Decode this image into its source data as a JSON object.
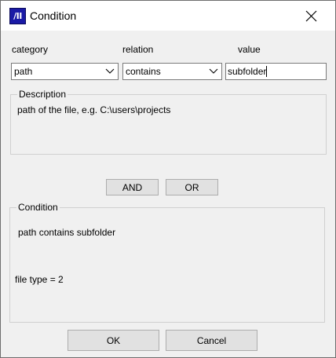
{
  "window": {
    "title": "Condition",
    "icon": "app-icon",
    "icon_text": "/II",
    "close": "close-icon"
  },
  "fields": {
    "category": {
      "label": "category",
      "value": "path"
    },
    "relation": {
      "label": "relation",
      "value": "contains"
    },
    "value": {
      "label": "value",
      "value": "subfolder"
    }
  },
  "description": {
    "legend": "Description",
    "text": "path of the file, e.g. C:\\users\\projects"
  },
  "logic": {
    "and_label": "AND",
    "or_label": "OR"
  },
  "condition": {
    "legend": "Condition",
    "line1": "path contains subfolder",
    "line2": "file type = 2"
  },
  "footer": {
    "ok_label": "OK",
    "cancel_label": "Cancel"
  },
  "colors": {
    "icon_bg": "#1a1aa6",
    "window_bg": "#f0f0f0",
    "titlebar_bg": "#ffffff",
    "button_bg": "#e1e1e1"
  }
}
